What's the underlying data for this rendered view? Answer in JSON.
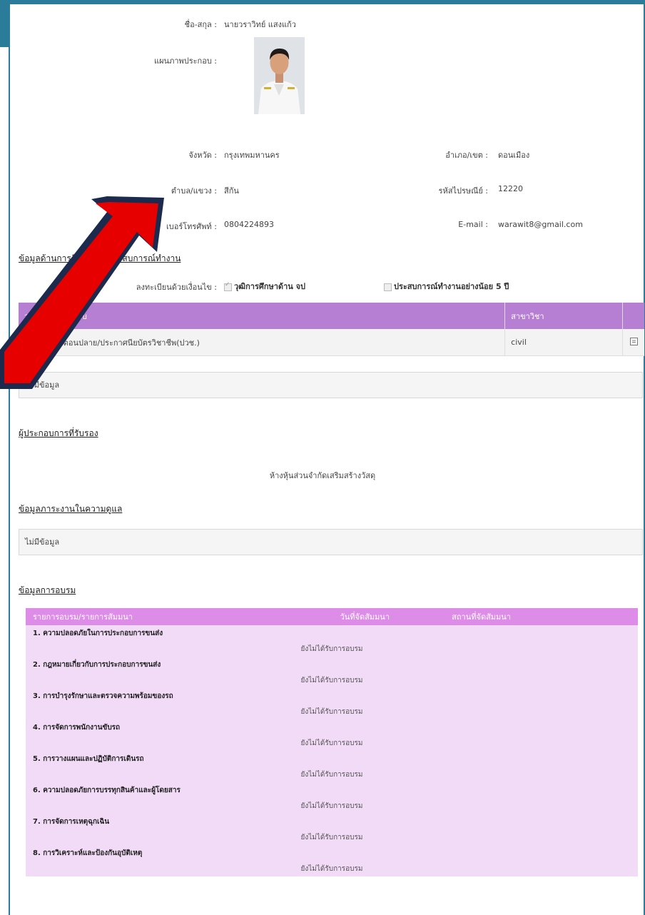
{
  "profile": {
    "name_label": "ชื่อ-สกุล :",
    "name_value": "นายวราวิทย์ แสงแก้ว",
    "photo_label": "แผนภาพประกอบ :"
  },
  "address": {
    "province_label": "จังหวัด :",
    "province_value": "กรุงเทพมหานคร",
    "district_label": "อำเภอ/เขต :",
    "district_value": "ดอนเมือง",
    "subdistrict_label": "ตำบล/แขวง :",
    "subdistrict_value": "สีกัน",
    "postal_label": "รหัสไปรษณีย์ :",
    "postal_value": "12220",
    "phone_label": "เบอร์โทรศัพท์ :",
    "phone_value": "0804224893",
    "email_label": "E-mail :",
    "email_value": "warawit8@gmail.com"
  },
  "education": {
    "section_title": "ข้อมูลด้านการศึกษาและประสบการณ์ทำงาน",
    "register_label": "ลงทะเบียนด้วยเงื่อนไข :",
    "option_education": "วุฒิการศึกษาด้าน จป",
    "option_experience": "ประสบการณ์ทำงานอย่างน้อย 5 ปี",
    "table_headers": [
      "วุฒิการศึกษาระดับ",
      "สาขาวิชา",
      ""
    ],
    "table_rows": [
      {
        "level": "มัธยมศึกษาตอนปลาย/ประกาศนียบัตรวิชาชีพ(ปวช.)",
        "major": "civil"
      }
    ],
    "nodata": "ไม่มีข้อมูล"
  },
  "certified": {
    "section_title": "ผู้ประกอบการที่รับรอง",
    "company": "ห้างหุ้นส่วนจำกัดเสริมสร้างวัสดุ"
  },
  "workload": {
    "section_title": "ข้อมูลภาระงานในความดูแล",
    "nodata": "ไม่มีข้อมูล"
  },
  "training": {
    "section_title": "ข้อมูลการอบรม",
    "headers": [
      "รายการอบรม/รายการสัมมนา",
      "วันที่จัดสัมมนา",
      "สถานที่จัดสัมมนา"
    ],
    "status_text": "ยังไม่ได้รับการอบรม",
    "courses": [
      "1. ความปลอดภัยในการประกอบการขนส่ง",
      "2. กฎหมายเกี่ยวกับการประกอบการขนส่ง",
      "3. การบำรุงรักษาและตรวจความพร้อมของรถ",
      "4. การจัดการพนักงานขับรถ",
      "5. การวางแผนและปฏิบัติการเดินรถ",
      "6. ความปลอดภัยการบรรทุกสินค้าและผู้โดยสาร",
      "7. การจัดการเหตุฉุกเฉิน",
      "8. การวิเคราะห์และป้องกันอุบัติเหตุ"
    ]
  },
  "colors": {
    "frame": "#2a7c9a",
    "edu_header": "#b77fd3",
    "train_header": "#dd8de8",
    "train_row": "#f2dbf6",
    "arrow": "#e60000"
  }
}
